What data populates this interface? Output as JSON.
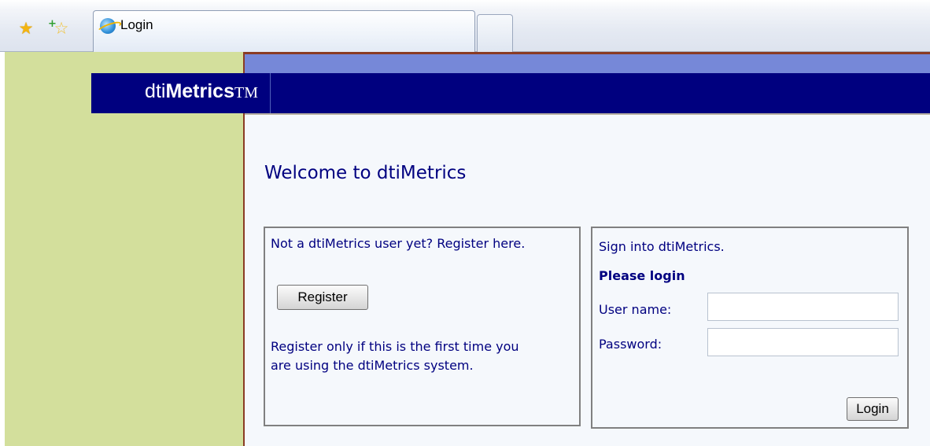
{
  "browser": {
    "tab_title": "Login"
  },
  "app": {
    "logo_prefix": "dti",
    "logo_bold": "Metrics",
    "logo_tm": "TM",
    "welcome": "Welcome to dtiMetrics"
  },
  "register": {
    "prompt": "Not a dtiMetrics user yet? Register here.",
    "button_label": "Register",
    "note_line1": "Register only if this is the first time you",
    "note_line2": "are using the dtiMetrics system."
  },
  "login": {
    "intro": "Sign into dtiMetrics.",
    "heading": "Please login",
    "username_label": "User name:",
    "username_value": "",
    "password_label": "Password:",
    "password_value": "",
    "button_label": "Login"
  }
}
